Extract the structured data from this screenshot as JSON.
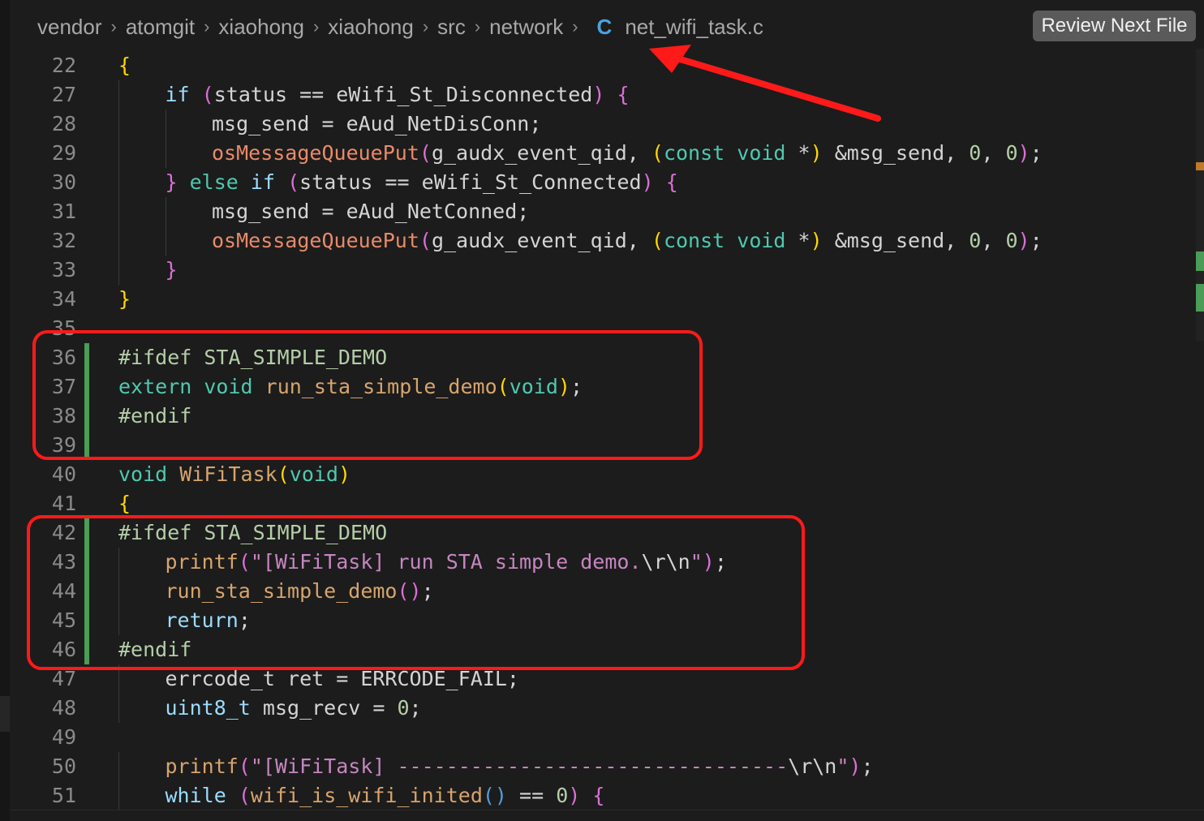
{
  "breadcrumb": {
    "items": [
      "vendor",
      "atomgit",
      "xiaohong",
      "xiaohong",
      "src",
      "network"
    ],
    "separator": "›",
    "file_icon": "C",
    "file_name": "net_wifi_task.c"
  },
  "review_button": {
    "label": "Review Next File"
  },
  "editor": {
    "lines": [
      {
        "n": "22",
        "indent": 0,
        "modified": false,
        "tokens": [
          [
            "{",
            "y"
          ]
        ]
      },
      {
        "n": "27",
        "indent": 1,
        "modified": false,
        "tokens": [
          [
            "if",
            "k"
          ],
          [
            " ",
            "d"
          ],
          [
            "(",
            "m"
          ],
          [
            "status == eWifi_St_Disconnected",
            "d"
          ],
          [
            ")",
            "m"
          ],
          [
            " ",
            "d"
          ],
          [
            "{",
            "m"
          ]
        ]
      },
      {
        "n": "28",
        "indent": 2,
        "modified": false,
        "tokens": [
          [
            "msg_send = eAud_NetDisConn;",
            "d"
          ]
        ]
      },
      {
        "n": "29",
        "indent": 2,
        "modified": false,
        "tokens": [
          [
            "osMessageQueuePut",
            "fu"
          ],
          [
            "(",
            "m"
          ],
          [
            "g_audx_event_qid, ",
            "d"
          ],
          [
            "(",
            "y"
          ],
          [
            "const",
            "c"
          ],
          [
            " ",
            "d"
          ],
          [
            "void",
            "c"
          ],
          [
            " *",
            "d"
          ],
          [
            ")",
            "y"
          ],
          [
            " &msg_send, ",
            "d"
          ],
          [
            "0",
            "g"
          ],
          [
            ", ",
            "d"
          ],
          [
            "0",
            "g"
          ],
          [
            ")",
            "m"
          ],
          [
            ";",
            "d"
          ]
        ]
      },
      {
        "n": "30",
        "indent": 1,
        "modified": false,
        "tokens": [
          [
            "}",
            "m"
          ],
          [
            " ",
            "d"
          ],
          [
            "else",
            "c"
          ],
          [
            " ",
            "d"
          ],
          [
            "if",
            "k"
          ],
          [
            " ",
            "d"
          ],
          [
            "(",
            "m"
          ],
          [
            "status == eWifi_St_Connected",
            "d"
          ],
          [
            ")",
            "m"
          ],
          [
            " ",
            "d"
          ],
          [
            "{",
            "m"
          ]
        ]
      },
      {
        "n": "31",
        "indent": 2,
        "modified": false,
        "tokens": [
          [
            "msg_send = eAud_NetConned;",
            "d"
          ]
        ]
      },
      {
        "n": "32",
        "indent": 2,
        "modified": false,
        "tokens": [
          [
            "osMessageQueuePut",
            "fu"
          ],
          [
            "(",
            "m"
          ],
          [
            "g_audx_event_qid, ",
            "d"
          ],
          [
            "(",
            "y"
          ],
          [
            "const",
            "c"
          ],
          [
            " ",
            "d"
          ],
          [
            "void",
            "c"
          ],
          [
            " *",
            "d"
          ],
          [
            ")",
            "y"
          ],
          [
            " &msg_send, ",
            "d"
          ],
          [
            "0",
            "g"
          ],
          [
            ", ",
            "d"
          ],
          [
            "0",
            "g"
          ],
          [
            ")",
            "m"
          ],
          [
            ";",
            "d"
          ]
        ]
      },
      {
        "n": "33",
        "indent": 1,
        "modified": false,
        "tokens": [
          [
            "}",
            "m"
          ]
        ]
      },
      {
        "n": "34",
        "indent": 0,
        "modified": false,
        "tokens": [
          [
            "}",
            "y"
          ]
        ]
      },
      {
        "n": "35",
        "indent": 0,
        "modified": false,
        "tokens": []
      },
      {
        "n": "36",
        "indent": 0,
        "modified": true,
        "tokens": [
          [
            "#ifdef STA_SIMPLE_DEMO",
            "g"
          ]
        ]
      },
      {
        "n": "37",
        "indent": 0,
        "modified": true,
        "tokens": [
          [
            "extern",
            "c"
          ],
          [
            " ",
            "d"
          ],
          [
            "void",
            "c"
          ],
          [
            " ",
            "d"
          ],
          [
            "run_sta_simple_demo",
            "f"
          ],
          [
            "(",
            "y"
          ],
          [
            "void",
            "c"
          ],
          [
            ")",
            "y"
          ],
          [
            ";",
            "d"
          ]
        ]
      },
      {
        "n": "38",
        "indent": 0,
        "modified": true,
        "tokens": [
          [
            "#endif",
            "g"
          ]
        ]
      },
      {
        "n": "39",
        "indent": 0,
        "modified": true,
        "tokens": []
      },
      {
        "n": "40",
        "indent": 0,
        "modified": false,
        "tokens": [
          [
            "void",
            "c"
          ],
          [
            " ",
            "d"
          ],
          [
            "WiFiTask",
            "f"
          ],
          [
            "(",
            "y"
          ],
          [
            "void",
            "c"
          ],
          [
            ")",
            "y"
          ]
        ]
      },
      {
        "n": "41",
        "indent": 0,
        "modified": false,
        "tokens": [
          [
            "{",
            "y"
          ]
        ]
      },
      {
        "n": "42",
        "indent": 0,
        "modified": true,
        "tokens": [
          [
            "#ifdef STA_SIMPLE_DEMO",
            "g"
          ]
        ]
      },
      {
        "n": "43",
        "indent": 1,
        "modified": true,
        "tokens": [
          [
            "printf",
            "f"
          ],
          [
            "(",
            "m"
          ],
          [
            "\"[WiFiTask] run STA simple demo.",
            "s"
          ],
          [
            "\\r\\n",
            "d"
          ],
          [
            "\"",
            "s"
          ],
          [
            ")",
            "m"
          ],
          [
            ";",
            "d"
          ]
        ]
      },
      {
        "n": "44",
        "indent": 1,
        "modified": true,
        "tokens": [
          [
            "run_sta_simple_demo",
            "f"
          ],
          [
            "()",
            "m"
          ],
          [
            ";",
            "d"
          ]
        ]
      },
      {
        "n": "45",
        "indent": 1,
        "modified": true,
        "tokens": [
          [
            "return",
            "k"
          ],
          [
            ";",
            "d"
          ]
        ]
      },
      {
        "n": "46",
        "indent": 0,
        "modified": true,
        "tokens": [
          [
            "#endif",
            "g"
          ]
        ]
      },
      {
        "n": "47",
        "indent": 1,
        "modified": false,
        "tokens": [
          [
            "errcode_t ret = ERRCODE_FAIL;",
            "d"
          ]
        ]
      },
      {
        "n": "48",
        "indent": 1,
        "modified": false,
        "tokens": [
          [
            "uint8_t",
            "k"
          ],
          [
            " msg_recv = ",
            "d"
          ],
          [
            "0",
            "g"
          ],
          [
            ";",
            "d"
          ]
        ]
      },
      {
        "n": "49",
        "indent": 0,
        "modified": false,
        "tokens": []
      },
      {
        "n": "50",
        "indent": 1,
        "modified": false,
        "tokens": [
          [
            "printf",
            "f"
          ],
          [
            "(",
            "m"
          ],
          [
            "\"[WiFiTask] --------------------------------",
            "s"
          ],
          [
            "\\r\\n",
            "d"
          ],
          [
            "\"",
            "s"
          ],
          [
            ")",
            "m"
          ],
          [
            ";",
            "d"
          ]
        ]
      },
      {
        "n": "51",
        "indent": 1,
        "modified": false,
        "tokens": [
          [
            "while",
            "k"
          ],
          [
            " ",
            "d"
          ],
          [
            "(",
            "m"
          ],
          [
            "wifi_is_wifi_inited",
            "f"
          ],
          [
            "()",
            "b"
          ],
          [
            " == ",
            "d"
          ],
          [
            "0",
            "g"
          ],
          [
            ")",
            "m"
          ],
          [
            " ",
            "d"
          ],
          [
            "{",
            "m"
          ]
        ]
      }
    ]
  },
  "colors": {
    "annotation": "#ff1a1a",
    "modified_gutter": "#4a9c56",
    "background": "#1c1c1c"
  }
}
